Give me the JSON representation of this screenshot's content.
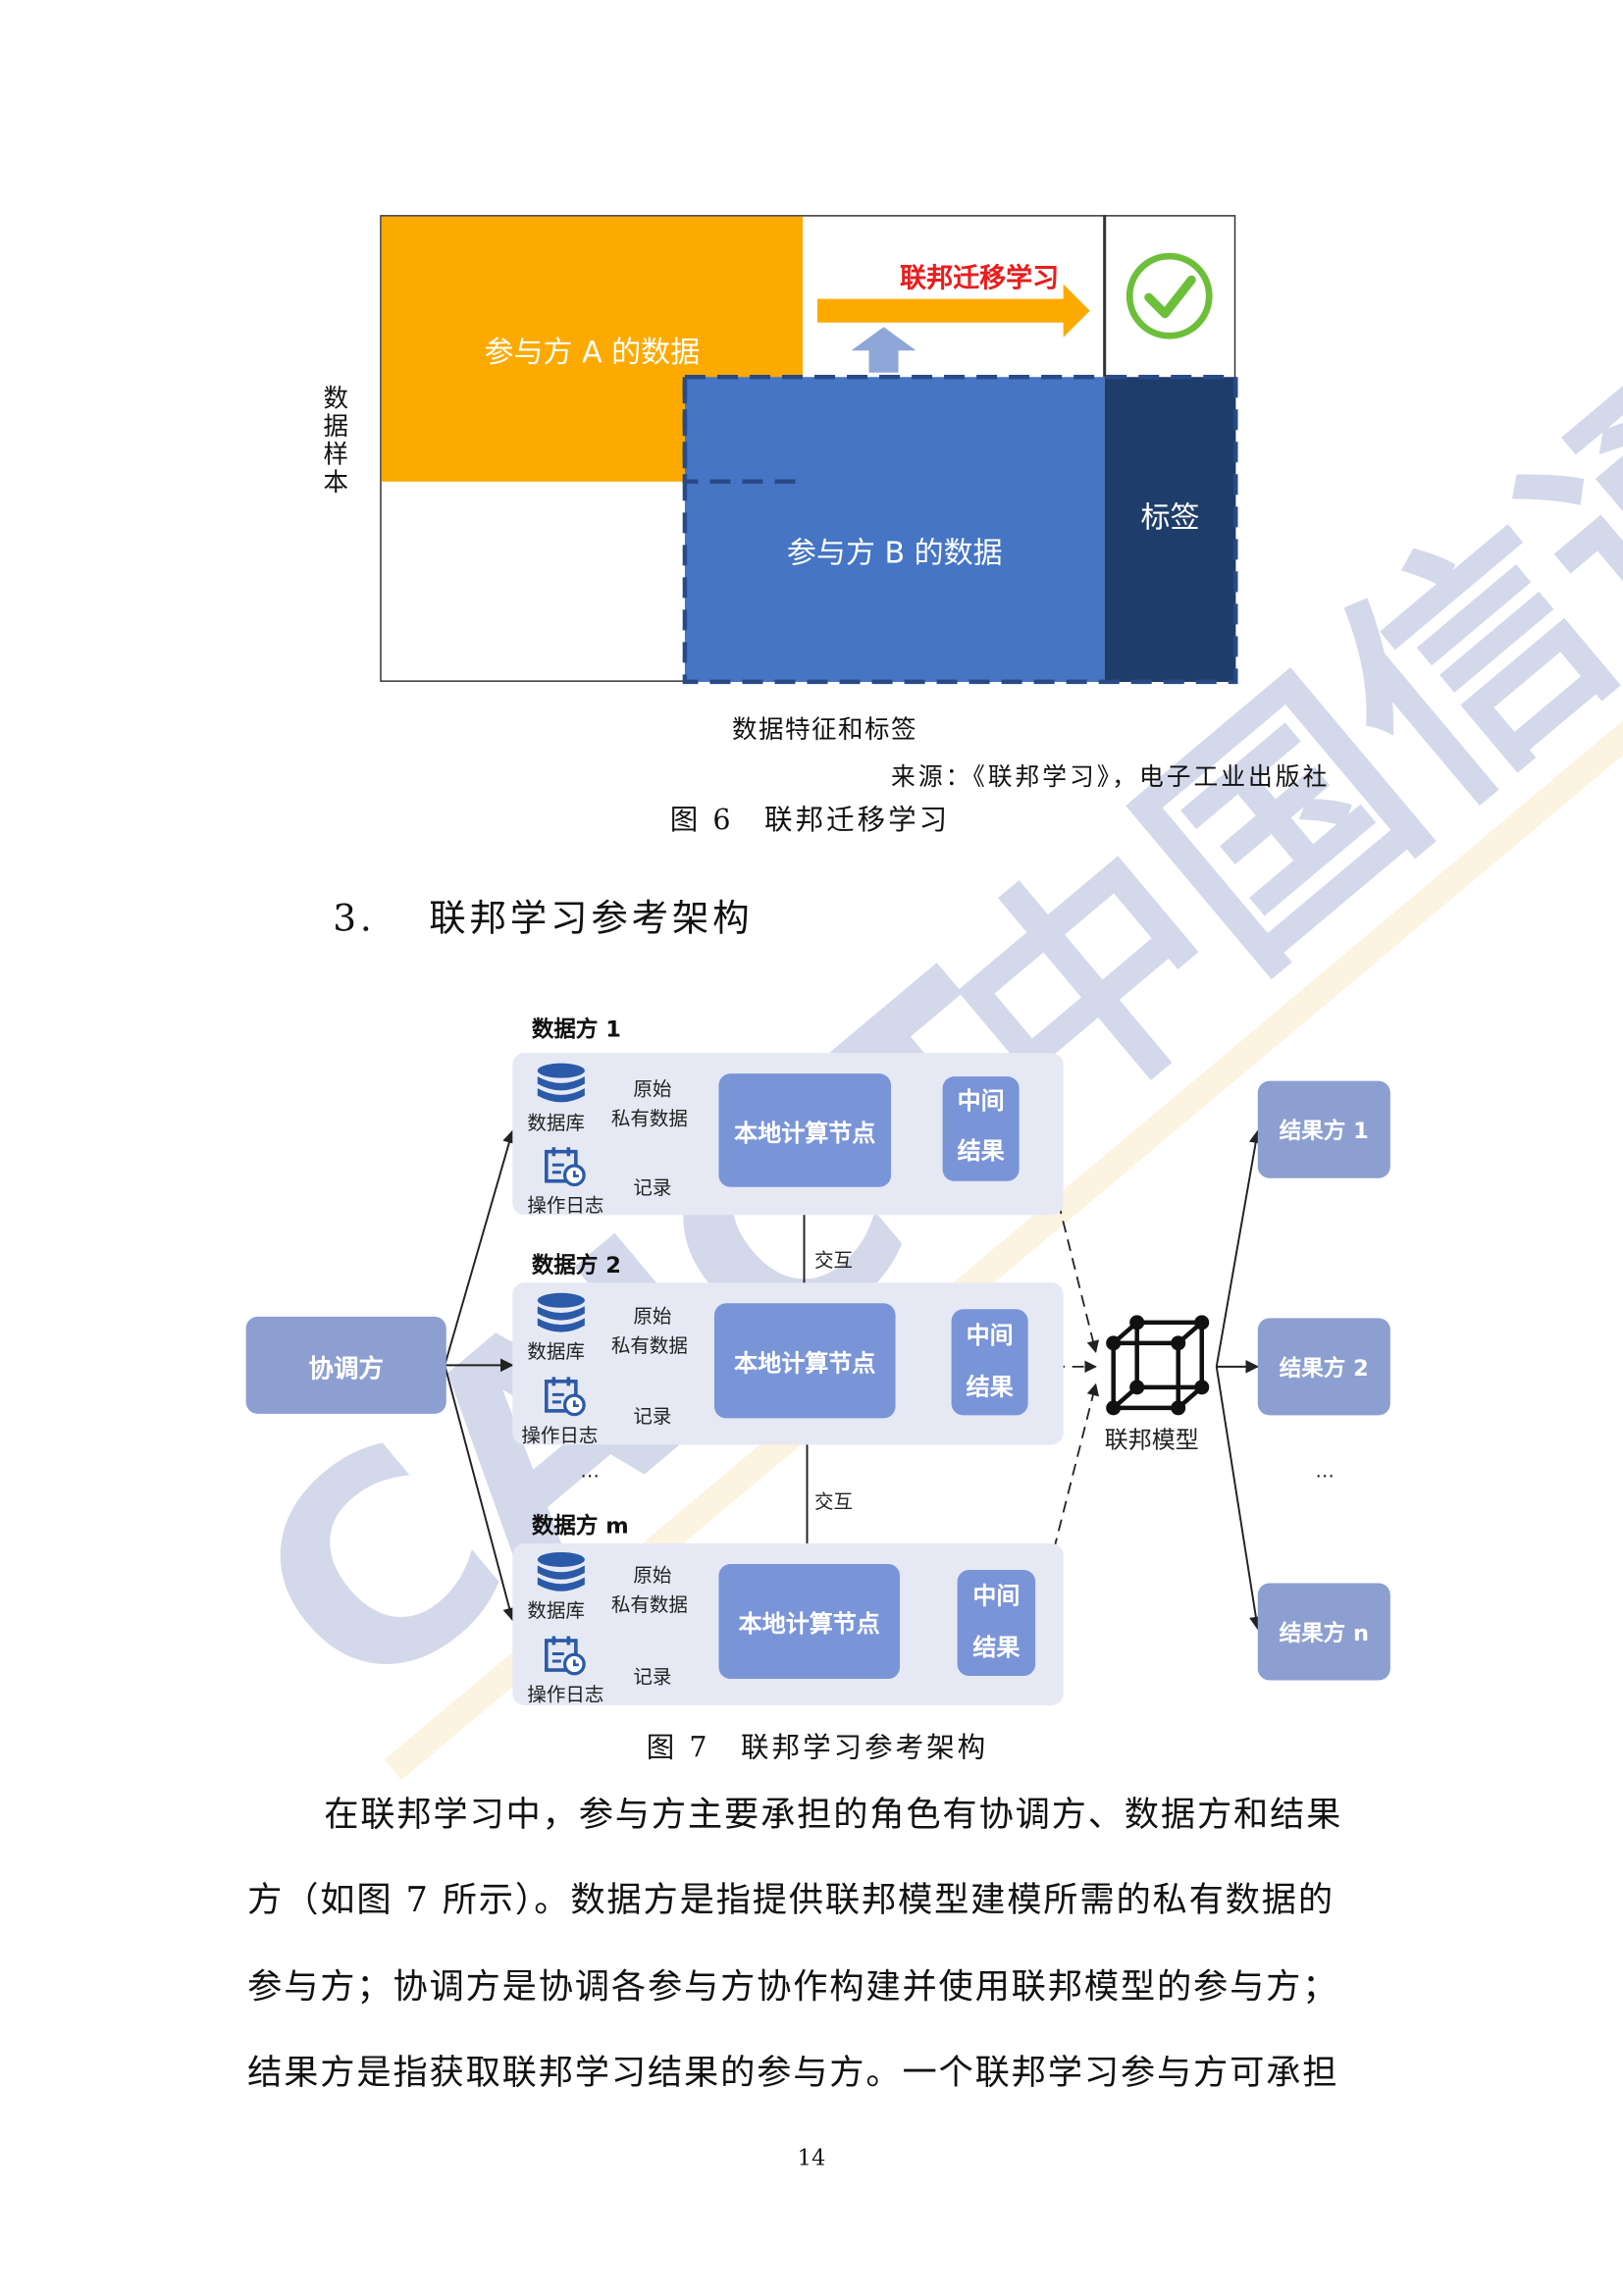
{
  "fig6": {
    "party_a": "参与方 A 的数据",
    "party_b": "参与方 B 的数据",
    "label": "标签",
    "arrow_text": "联邦迁移学习",
    "y_axis": "数据样本",
    "x_axis": "数据特征和标签",
    "source": "来源：《联邦学习》，电子工业出版社",
    "caption": "图 6　联邦迁移学习"
  },
  "section": {
    "number": "3.",
    "title": "联邦学习参考架构"
  },
  "fig7": {
    "coordinator": "协调方",
    "data_parties": [
      {
        "title": "数据方 1",
        "db": "数据库",
        "log": "操作日志",
        "raw1": "原始",
        "raw2": "私有数据",
        "record": "记录",
        "node1": "本地计算节点",
        "mid1": "中间",
        "mid2": "结果"
      },
      {
        "title": "数据方 2",
        "db": "数据库",
        "log": "操作日志",
        "raw1": "原始",
        "raw2": "私有数据",
        "record": "记录",
        "node1": "本地计算节点",
        "mid1": "中间",
        "mid2": "结果"
      },
      {
        "title": "数据方 m",
        "db": "数据库",
        "log": "操作日志",
        "raw1": "原始",
        "raw2": "私有数据",
        "record": "记录",
        "node1": "本地计算节点",
        "mid1": "中间",
        "mid2": "结果"
      }
    ],
    "interact": "交互",
    "model": "联邦模型",
    "results": [
      "结果方 1",
      "结果方 2",
      "结果方 n"
    ],
    "ellipsis": "…",
    "caption": "图 7　联邦学习参考架构"
  },
  "body": [
    "在联邦学习中，参与方主要承担的角色有协调方、数据方和结果",
    "方（如图 7 所示）。数据方是指提供联邦模型建模所需的私有数据的",
    "参与方；协调方是协调各参与方协作构建并使用联邦模型的参与方；",
    "结果方是指获取联邦学习结果的参与方。一个联邦学习参与方可承担"
  ],
  "page_number": "14",
  "watermark": "CAICT 中国信通院",
  "colors": {
    "orange": "#fcaa00",
    "blue": "#4575c4",
    "navy": "#1f3d6b",
    "red_text": "#e81e1e",
    "node": "#7a94d8",
    "panel": "#e6e9f4",
    "check_green": "#6cbf3a"
  }
}
